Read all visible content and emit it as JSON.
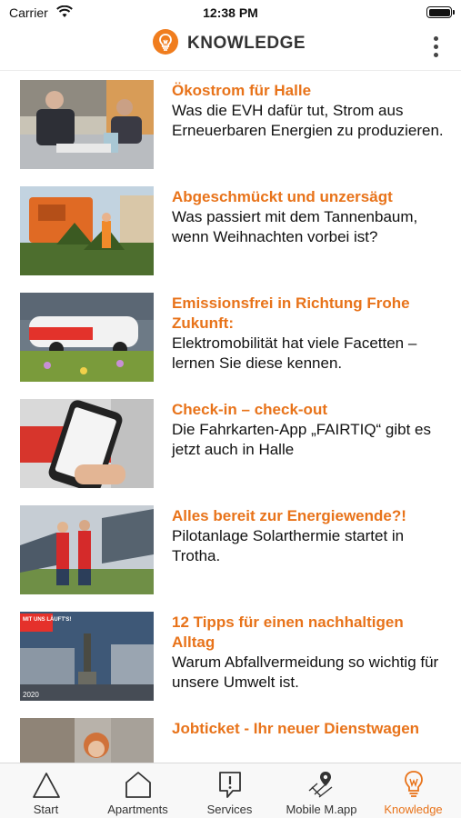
{
  "status_bar": {
    "carrier": "Carrier",
    "time": "12:38 PM"
  },
  "header": {
    "title": "KNOWLEDGE",
    "logo_icon": "lightbulb-icon",
    "menu_icon": "more-vertical-icon"
  },
  "articles": [
    {
      "title": "Ökostrom für Halle",
      "description": "Was die EVH dafür tut, Strom aus Erneuerbaren Energien zu produzieren."
    },
    {
      "title": "Abgeschmückt und unzersägt",
      "description": "Was passiert mit dem Tannenbaum, wenn Weihnachten vorbei ist?"
    },
    {
      "title": "Emissionsfrei in Richtung Frohe Zukunft:",
      "description": "Elektromobilität hat viele Facetten – lernen Sie diese kennen."
    },
    {
      "title": "Check-in – check-out",
      "description": "Die Fahrkarten-App „FAIRTIQ“ gibt es jetzt auch in Halle"
    },
    {
      "title": "Alles bereit zur Energiewende?!",
      "description": "Pilotanlage Solarthermie startet in Trotha."
    },
    {
      "title": "12 Tipps für einen nachhaltigen Alltag",
      "description": "Warum Abfallvermeidung so wichtig für unsere Umwelt ist.",
      "badge_text": "MIT UNS LÄUFT'S!",
      "year_text": "2020"
    },
    {
      "title": "Jobticket - Ihr neuer Dienstwagen",
      "description": ""
    }
  ],
  "tabs": [
    {
      "label": "Start",
      "icon": "triangle-icon"
    },
    {
      "label": "Apartments",
      "icon": "house-icon"
    },
    {
      "label": "Services",
      "icon": "service-exclamation-icon"
    },
    {
      "label": "Mobile M.app",
      "icon": "map-pin-icon"
    },
    {
      "label": "Knowledge",
      "icon": "lightbulb-icon",
      "active": true
    }
  ],
  "colors": {
    "accent": "#e8731a",
    "logo": "#f07d1e",
    "text": "#111111",
    "tab_bar": "#f8f8f8"
  }
}
